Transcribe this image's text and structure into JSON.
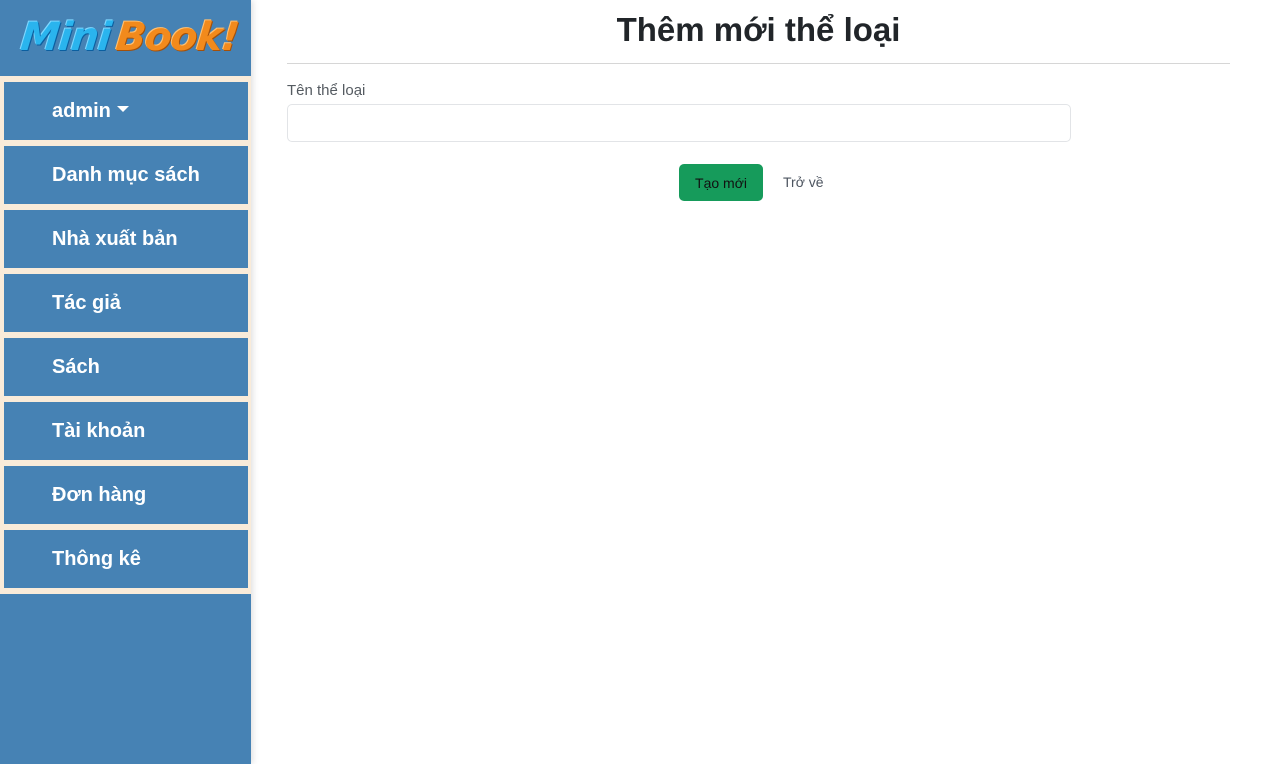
{
  "brand": {
    "logo_part1": "Mini",
    "logo_part2": "Book!",
    "colors": {
      "mini": "#2ab4ee",
      "book": "#f28a1c",
      "sidebar": "#4682b4",
      "menu_gap": "#f9ebd9",
      "create_button": "#169b5b"
    }
  },
  "sidebar": {
    "items": [
      {
        "label": "admin",
        "has_dropdown": true,
        "icon": "caret-down-icon"
      },
      {
        "label": "Danh mục sách"
      },
      {
        "label": "Nhà xuất bản"
      },
      {
        "label": "Tác giả"
      },
      {
        "label": "Sách"
      },
      {
        "label": "Tài khoản"
      },
      {
        "label": "Đơn hàng"
      },
      {
        "label": "Thông kê"
      }
    ]
  },
  "main": {
    "title": "Thêm mới thể loại",
    "form": {
      "field_label": "Tên thể loại",
      "field_value": "",
      "field_placeholder": ""
    },
    "actions": {
      "create_label": "Tạo mới",
      "back_label": "Trở về"
    }
  }
}
